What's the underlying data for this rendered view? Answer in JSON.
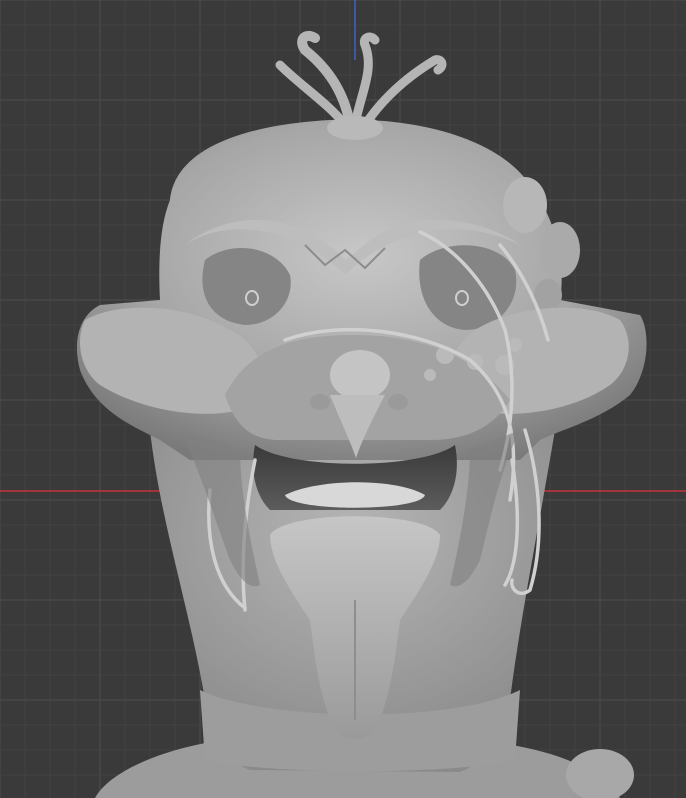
{
  "viewport": {
    "background_color": "#3a3a3a",
    "grid_minor_color": "#434343",
    "grid_major_color": "#4d4d4d",
    "x_axis_color": "#c8323c",
    "z_axis_color": "#3c64c8",
    "model_base_color": "#a9a9a9",
    "model_shadow_color": "#5c5c5c",
    "model_highlight_color": "#d4d4d4"
  },
  "model": {
    "name_icon": "sculpted-creature-head",
    "features": [
      "head-tentacles-icon",
      "brow",
      "eyes",
      "nose",
      "whiskers",
      "mouth",
      "tongue",
      "neck"
    ]
  }
}
